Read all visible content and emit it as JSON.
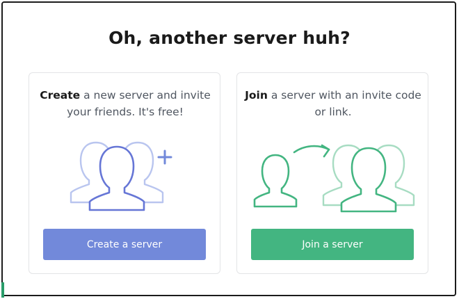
{
  "modal": {
    "title": "Oh, another server huh?"
  },
  "create": {
    "bold": "Create",
    "desc_rest": " a new server and invite your friends. It's free!",
    "button_label": "Create a server",
    "illustration": "create-server-people-icon",
    "color": "#7289da"
  },
  "join": {
    "bold": "Join",
    "desc_rest": " a server with an invite code or link.",
    "button_label": "Join a server",
    "illustration": "join-server-people-icon",
    "color": "#43b581"
  }
}
